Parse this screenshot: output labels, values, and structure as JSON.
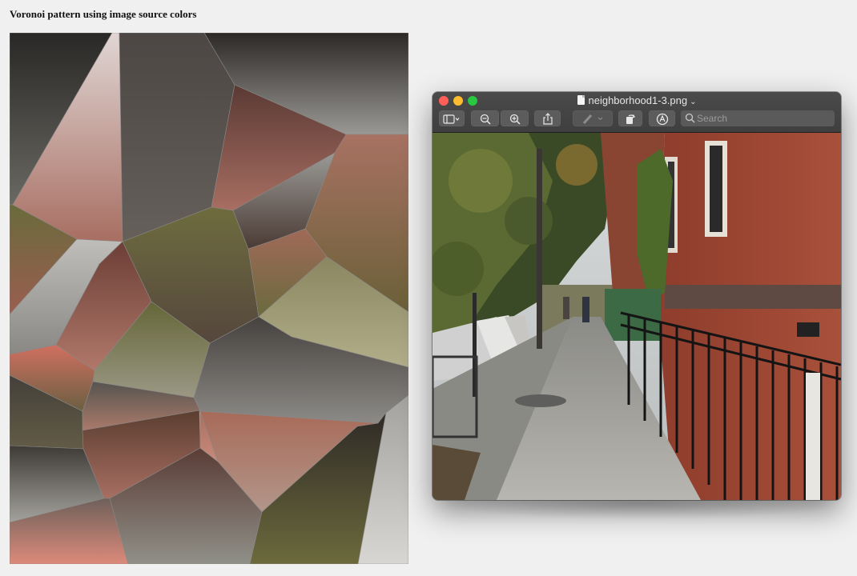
{
  "page": {
    "title": "Voronoi pattern using image source colors"
  },
  "preview_window": {
    "filename": "neighborhood1-3.png",
    "search_placeholder": "Search",
    "toolbar": [
      "sidebar-toggle",
      "zoom-out",
      "zoom-in",
      "share",
      "markup-pen",
      "rotate",
      "markup-toolbar"
    ]
  },
  "colors": {
    "page_bg": "#f0f0f0",
    "window_chrome": "#3f3f3f",
    "traffic_close": "#ff5f57",
    "traffic_min": "#febc2e",
    "traffic_max": "#28c840"
  }
}
